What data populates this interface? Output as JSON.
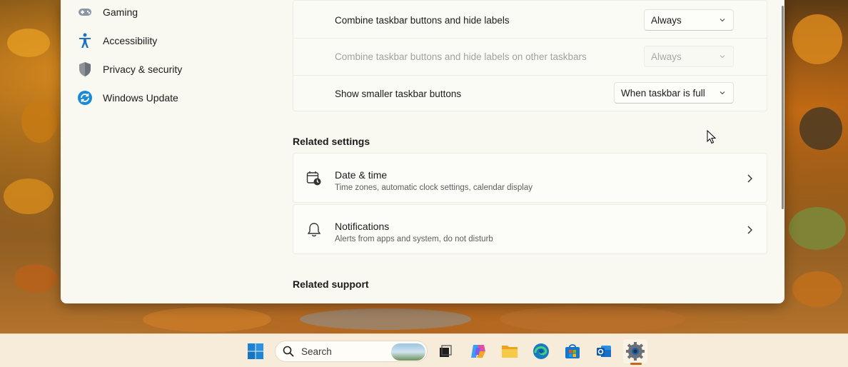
{
  "nav": {
    "items": [
      {
        "label": "Gaming",
        "icon": "gaming-icon"
      },
      {
        "label": "Accessibility",
        "icon": "accessibility-icon"
      },
      {
        "label": "Privacy & security",
        "icon": "shield-icon"
      },
      {
        "label": "Windows Update",
        "icon": "windows-update-icon"
      }
    ]
  },
  "taskbar_behaviors": {
    "rows": [
      {
        "label": "Combine taskbar buttons and hide labels",
        "value": "Always",
        "disabled": false
      },
      {
        "label": "Combine taskbar buttons and hide labels on other taskbars",
        "value": "Always",
        "disabled": true
      },
      {
        "label": "Show smaller taskbar buttons",
        "value": "When taskbar is full",
        "disabled": false
      }
    ]
  },
  "related_settings": {
    "title": "Related settings",
    "items": [
      {
        "title": "Date & time",
        "subtitle": "Time zones, automatic clock settings, calendar display",
        "icon": "date-time-icon"
      },
      {
        "title": "Notifications",
        "subtitle": "Alerts from apps and system, do not disturb",
        "icon": "bell-icon"
      }
    ]
  },
  "related_support": {
    "title": "Related support"
  },
  "taskbar": {
    "search_placeholder": "Search",
    "apps": [
      "start-icon",
      "task-view-icon",
      "copilot-icon",
      "file-explorer-icon",
      "edge-icon",
      "store-icon",
      "outlook-icon",
      "settings-icon"
    ],
    "active_app": "settings-icon",
    "accent_color": "#c9651b"
  },
  "colors": {
    "window_bg": "#f9f9f2",
    "card_bg": "#fbfbf6",
    "windows_blue": "#0078d4"
  }
}
